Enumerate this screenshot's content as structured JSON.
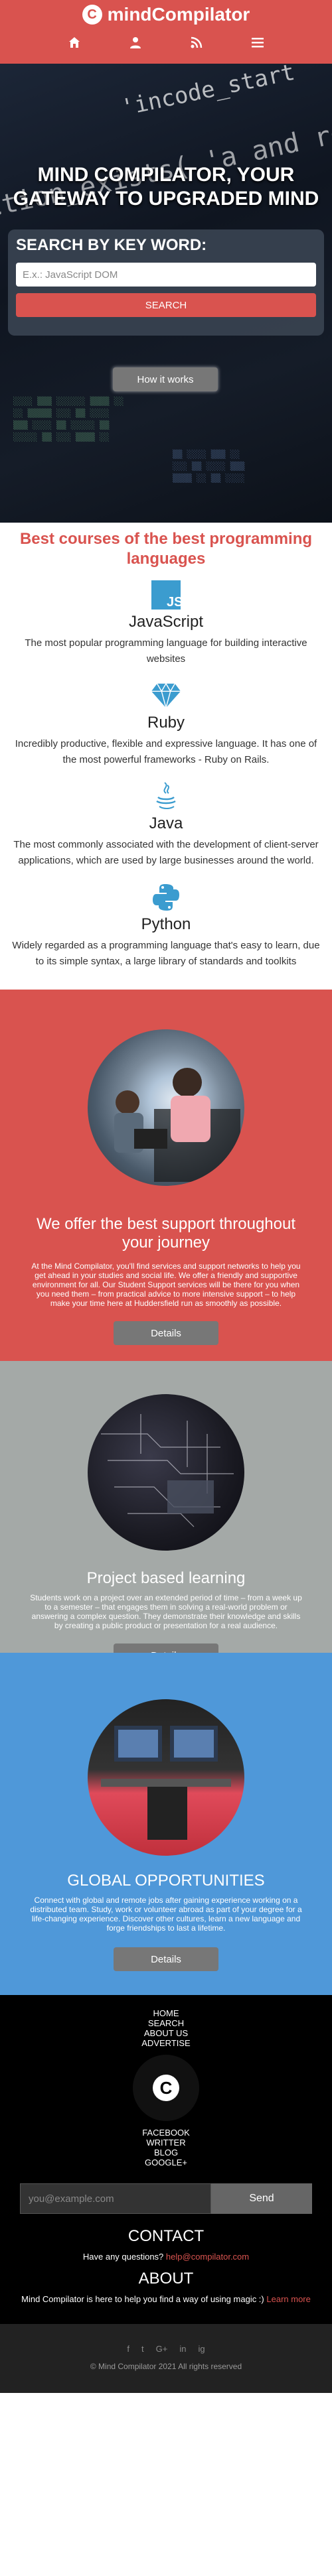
{
  "header": {
    "brand": "mindCompilator",
    "logo_letter": "C",
    "nav_icons": [
      "home-icon",
      "user-icon",
      "rss-icon",
      "menu-icon"
    ]
  },
  "hero": {
    "code_line_1": "'incode_start",
    "code_line_2": "ction_exists( 'a and registers supp",
    "title": "MIND COMPILATOR, YOUR GATEWAY TO UPGRADED MIND",
    "search_label": "SEARCH BY KEY WORD:",
    "search_placeholder": "E.x.: JavaScript DOM",
    "search_button": "SEARCH",
    "how_button": "How it works"
  },
  "courses": {
    "heading": "Best courses of the best programming languages",
    "items": [
      {
        "icon": "js-icon",
        "title": "JavaScript",
        "desc": "The most popular programming language for building interactive websites"
      },
      {
        "icon": "ruby-icon",
        "title": "Ruby",
        "desc": "Incredibly productive, flexible and expressive language. It has one of the most powerful frameworks - Ruby on Rails."
      },
      {
        "icon": "java-icon",
        "title": "Java",
        "desc": "The most commonly associated with the development of client-server applications, which are used by large businesses around the world."
      },
      {
        "icon": "python-icon",
        "title": "Python",
        "desc": "Widely regarded as a programming language that's easy to learn, due to its simple syntax, a large library of standards and toolkits"
      }
    ]
  },
  "features": [
    {
      "title": "We offer the best support throughout your journey",
      "text": "At the Mind Compilator, you'll find services and support networks to help you get ahead in your studies and social life. We offer a friendly and supportive environment for all. Our Student Support services will be there for you when you need them – from practical advice to more intensive support – to help make your time here at Huddersfield run as smoothly as possible.",
      "button": "Details",
      "color": "#d9534f"
    },
    {
      "title": "Project based learning",
      "text": "Students work on a project over an extended period of time – from a week up to a semester – that engages them in solving a real-world problem or answering a complex question. They demonstrate their knowledge and skills by creating a public product or presentation for a real audience.",
      "button": "Details",
      "color": "#a4a9a7"
    },
    {
      "title": "GLOBAL OPPORTUNITIES",
      "text": "Connect with global and remote jobs after gaining experience working on a distributed team. Study, work or volunteer abroad as part of your degree for a life-changing experience. Discover other cultures, learn a new language and forge friendships to last a lifetime.",
      "button": "Details",
      "color": "#4f98d9"
    }
  ],
  "footer": {
    "links_top": [
      "HOME",
      "SEARCH",
      "ABOUT US",
      "ADVERTISE"
    ],
    "links_bottom": [
      "FACEBOOK",
      "WRITTER",
      "BLOG",
      "GOOGLE+"
    ],
    "email_placeholder": "you@example.com",
    "send_button": "Send",
    "contact_heading": "CONTACT",
    "contact_text": "Have any questions?",
    "contact_email": "help@compilator.com",
    "about_heading": "ABOUT",
    "about_text": "Mind Compilator is here to help you find a way of using magic :)",
    "about_link": "Learn more",
    "social_icons": [
      "f",
      "t",
      "G+",
      "in",
      "ig"
    ],
    "copyright": "© Mind Compilator 2021 All rights reserved"
  },
  "colors": {
    "accent": "#d9534f",
    "blue": "#4f98d9",
    "gray": "#a4a9a7",
    "button_gray": "#777777"
  }
}
